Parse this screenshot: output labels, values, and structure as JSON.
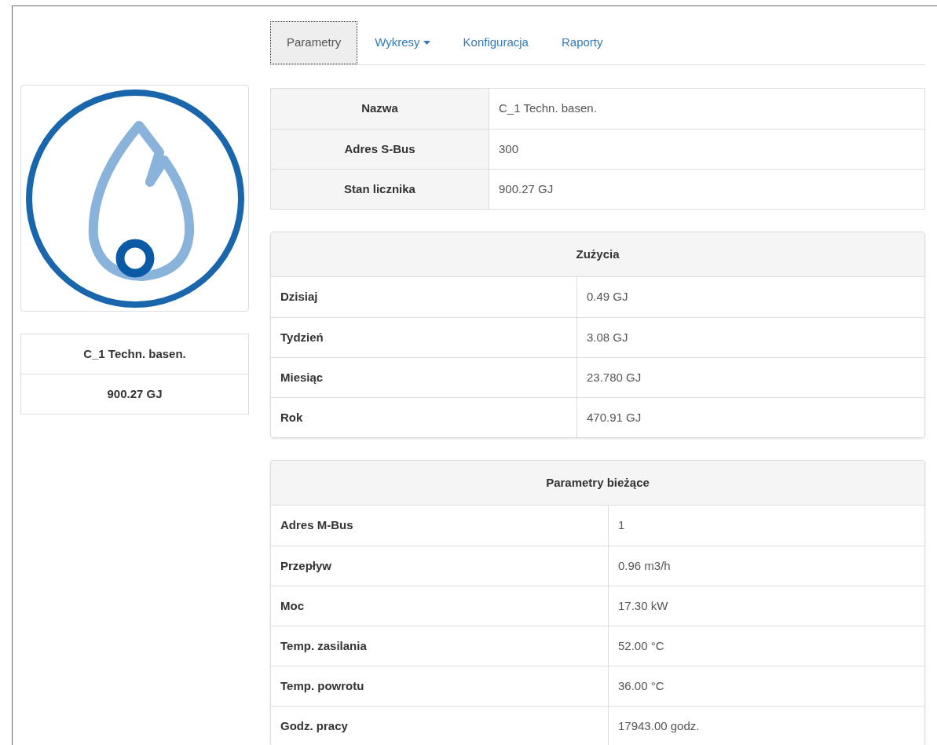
{
  "tabs": [
    {
      "label": "Parametry",
      "selected": true,
      "dropdown": false
    },
    {
      "label": "Wykresy",
      "selected": false,
      "dropdown": true
    },
    {
      "label": "Konfiguracja",
      "selected": false,
      "dropdown": false
    },
    {
      "label": "Raporty",
      "selected": false,
      "dropdown": false
    }
  ],
  "device": {
    "name": "C_1 Techn. basen.",
    "reading": "900.27 GJ"
  },
  "info_table": [
    {
      "label": "Nazwa",
      "value": "C_1 Techn. basen."
    },
    {
      "label": "Adres S-Bus",
      "value": "300"
    },
    {
      "label": "Stan licznika",
      "value": "900.27 GJ"
    }
  ],
  "usage": {
    "title": "Zużycia",
    "rows": [
      {
        "label": "Dzisiaj",
        "value": "0.49 GJ"
      },
      {
        "label": "Tydzień",
        "value": "3.08 GJ"
      },
      {
        "label": "Miesiąc",
        "value": "23.780 GJ"
      },
      {
        "label": "Rok",
        "value": "470.91 GJ"
      }
    ]
  },
  "current": {
    "title": "Parametry bieżące",
    "rows": [
      {
        "label": "Adres M-Bus",
        "value": "1"
      },
      {
        "label": "Przepływ",
        "value": "0.96 m3/h"
      },
      {
        "label": "Moc",
        "value": "17.30 kW"
      },
      {
        "label": "Temp. zasilania",
        "value": "52.00 °C"
      },
      {
        "label": "Temp. powrotu",
        "value": "36.00 °C"
      },
      {
        "label": "Godz. pracy",
        "value": "17943.00 godz."
      }
    ]
  }
}
